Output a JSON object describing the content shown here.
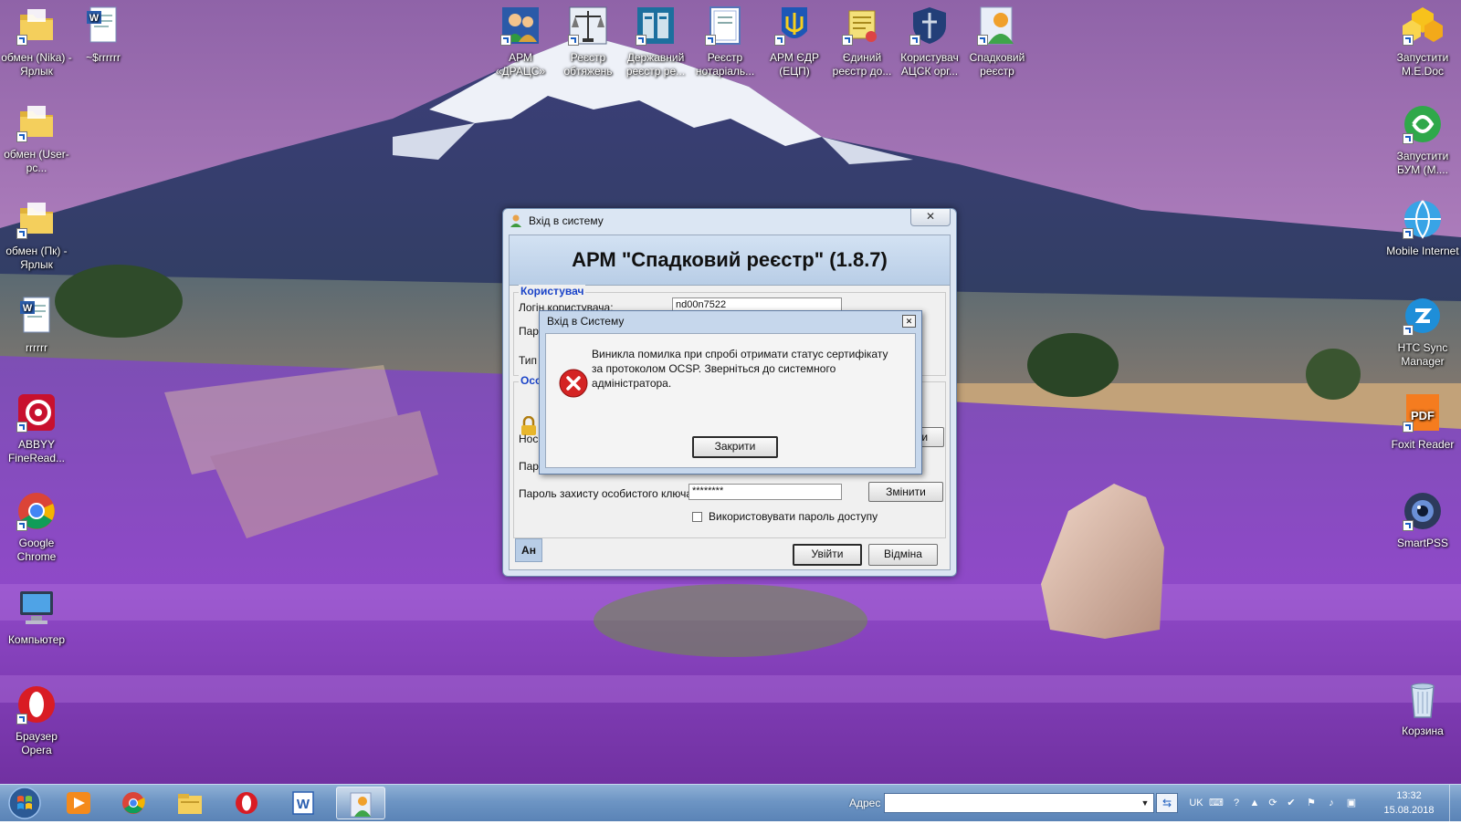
{
  "desktop": {
    "icons_left": [
      {
        "label": "обмен (Nika) - Ярлык",
        "icon": "folder-icon"
      },
      {
        "label": "~$rrrrrr",
        "icon": "word-doc-icon"
      },
      {
        "label": "обмен (User-pc...",
        "icon": "folder-icon"
      },
      {
        "label": "обмен (Пк) - Ярлык",
        "icon": "folder-icon"
      },
      {
        "label": "rrrrrr",
        "icon": "word-doc-icon"
      },
      {
        "label": "ABBYY FineRead...",
        "icon": "abbyy-icon"
      },
      {
        "label": "Google Chrome",
        "icon": "chrome-icon"
      },
      {
        "label": "Компьютер",
        "icon": "computer-icon"
      },
      {
        "label": "Браузер Opera",
        "icon": "opera-icon"
      }
    ],
    "icons_top": [
      {
        "label": "АРМ «ДРАЦС»",
        "icon": "people-icon"
      },
      {
        "label": "Реєстр обтяжень",
        "icon": "scales-icon"
      },
      {
        "label": "Державний реєстр ре...",
        "icon": "registry-icon"
      },
      {
        "label": "Реєстр нотаріаль...",
        "icon": "certificate-icon"
      },
      {
        "label": "АРМ ЄДР (ЕЦП)",
        "icon": "trident-icon"
      },
      {
        "label": "Єдиний реєстр до...",
        "icon": "scroll-icon"
      },
      {
        "label": "Користувач АЦСК орг...",
        "icon": "shield-icon"
      },
      {
        "label": "Спадковий реєстр",
        "icon": "heir-user-icon"
      }
    ],
    "icons_right": [
      {
        "label": "Запустити M.E.Doc",
        "icon": "medoc-icon"
      },
      {
        "label": "Запустити БУМ (M....",
        "icon": "bum-icon"
      },
      {
        "label": "Mobile Internet",
        "icon": "globe-icon"
      },
      {
        "label": "HTC Sync Manager",
        "icon": "htc-sync-icon"
      },
      {
        "label": "Foxit Reader",
        "icon": "foxit-icon"
      },
      {
        "label": "SmartPSS",
        "icon": "camera-icon"
      },
      {
        "label": "Корзина",
        "icon": "recycle-bin-icon"
      }
    ]
  },
  "login_window": {
    "title": "Вхід в систему",
    "close_glyph": "✕",
    "header": "АРМ \"Спадковий реєстр\" (1.8.7)",
    "user_group": "Користувач",
    "login_label": "Логін користувача:",
    "login_value": "nd00n7522",
    "password_label_partial": "Парол",
    "type_label_partial": "Тип п",
    "key_group_partial": "Осо",
    "carrier_label_partial": "Носій",
    "carrier_button_partial": "ти",
    "key_password_label_partial": "Паро",
    "key_protect_label": "Пароль захисту особистого ключа:",
    "key_protect_value": "********",
    "change_button": "Змінити",
    "use_password_checkbox": "Використовувати пароль доступу",
    "lang_badge": "Ан",
    "login_button": "Увійти",
    "cancel_button": "Відміна"
  },
  "error_dialog": {
    "title": "Вхід в Систему",
    "close_glyph": "✕",
    "message": "Виникла помилка при спробі отримати статус сертифікату за протоколом OCSP. Зверніться до системного адміністратора.",
    "close_button": "Закрити"
  },
  "taskbar": {
    "address_label": "Адрес",
    "address_value": "",
    "keyboard_lang": "UK",
    "clock_time": "13:32",
    "clock_date": "15.08.2018",
    "pinned": [
      "media-player-icon",
      "chrome-icon",
      "explorer-icon",
      "opera-icon",
      "word-icon",
      "heir-user-icon"
    ],
    "active_pinned_index": 5
  }
}
